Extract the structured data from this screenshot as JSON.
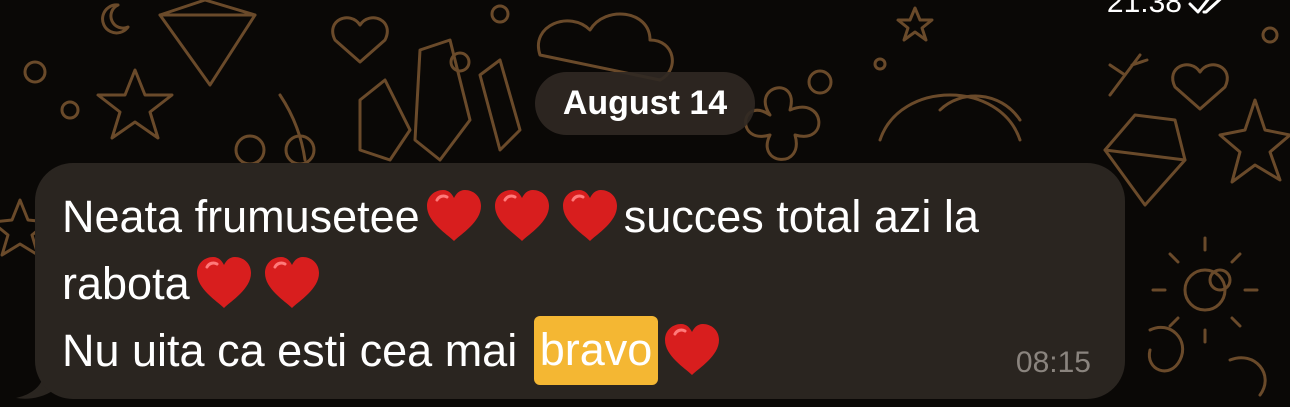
{
  "previous_message": {
    "time": "21:38",
    "status_icon": "double-check-icon"
  },
  "date_separator": {
    "label": "August 14"
  },
  "message": {
    "line1_text1": "Neata frumusetee",
    "line1_text2": "succes total azi la",
    "line2_text1": "rabota",
    "line3_text1": "Nu uita ca esti cea mai ",
    "line3_highlight": "bravo",
    "time": "08:15",
    "heart_icon": "red-heart-emoji",
    "highlight_color": "#f4b733"
  },
  "colors": {
    "background": "#0a0806",
    "bubble": "#2a2520",
    "pattern": "#6a4a2a",
    "text": "#ffffff",
    "timestamp": "#8a847e"
  }
}
